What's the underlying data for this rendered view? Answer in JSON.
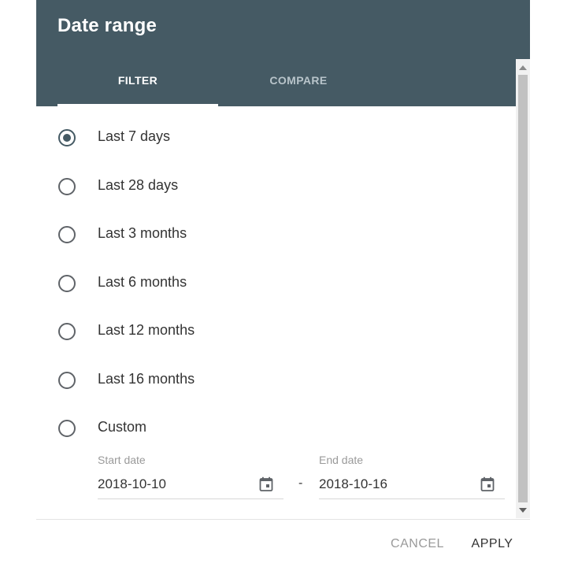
{
  "dialog": {
    "title": "Date range",
    "tabs": [
      {
        "label": "FILTER",
        "active": true
      },
      {
        "label": "COMPARE",
        "active": false
      }
    ],
    "options": [
      {
        "label": "Last 7 days",
        "selected": true
      },
      {
        "label": "Last 28 days",
        "selected": false
      },
      {
        "label": "Last 3 months",
        "selected": false
      },
      {
        "label": "Last 6 months",
        "selected": false
      },
      {
        "label": "Last 12 months",
        "selected": false
      },
      {
        "label": "Last 16 months",
        "selected": false
      },
      {
        "label": "Custom",
        "selected": false
      }
    ],
    "custom_range": {
      "start_label": "Start date",
      "start_value": "2018-10-10",
      "separator": "-",
      "end_label": "End date",
      "end_value": "2018-10-16"
    },
    "actions": {
      "cancel": "CANCEL",
      "apply": "APPLY"
    }
  },
  "colors": {
    "header": "#455a64",
    "accent": "#455a64",
    "text": "#333333",
    "muted": "#9a9a9a"
  },
  "icons": {
    "selected_radio": "radio-checked-icon",
    "unselected_radio": "radio-unchecked-icon",
    "date_picker": "calendar-icon",
    "scroll_up": "chevron-up-icon",
    "scroll_down": "chevron-down-icon"
  }
}
